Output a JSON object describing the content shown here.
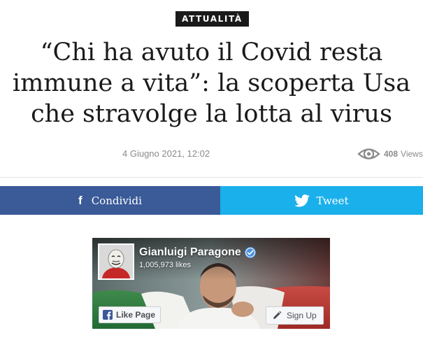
{
  "article": {
    "category": "ATTUALITÀ",
    "headline_lines": [
      "“Chi ha avuto il Covid resta",
      "immune a vita”: la scoperta Usa",
      "che stravolge la lotta al virus"
    ],
    "date": "4 Giugno 2021, 12:02",
    "views": {
      "count": "408",
      "label": "Views",
      "icon": "eye-icon"
    }
  },
  "share": {
    "facebook": {
      "label": "Condividi",
      "icon": "facebook-f-icon",
      "color": "#3a5a98"
    },
    "twitter": {
      "label": "Tweet",
      "icon": "twitter-bird-icon",
      "color": "#1ab0eb"
    }
  },
  "fb_widget": {
    "page_name": "Gianluigi Paragone",
    "likes": "1,005,973 likes",
    "verified_icon": "verified-badge-icon",
    "like_button": {
      "label": "Like Page",
      "icon": "facebook-square-icon"
    },
    "signup_button": {
      "label": "Sign Up",
      "icon": "pencil-icon"
    }
  },
  "colors": {
    "category_bg": "#1a1a1a",
    "headline": "#1a1a1a",
    "meta_text": "#8a8a8a",
    "facebook_blue": "#3a5a98",
    "twitter_blue": "#1ab0eb"
  }
}
